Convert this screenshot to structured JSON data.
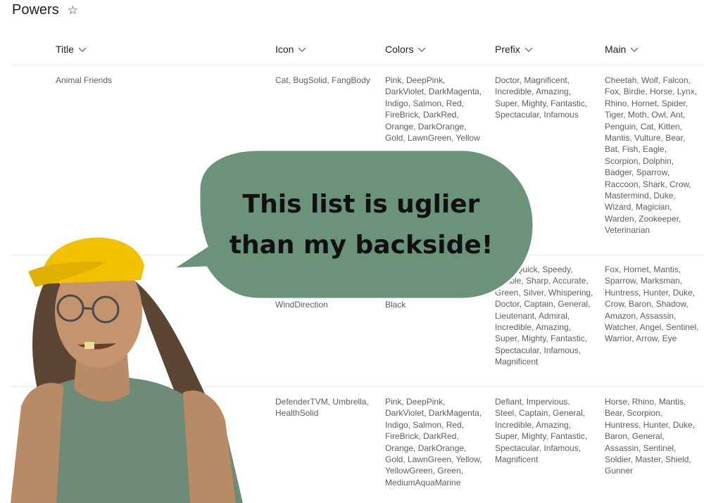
{
  "page": {
    "title": "Powers",
    "star_icon": "star-outline-icon"
  },
  "columns": [
    {
      "label": "Title"
    },
    {
      "label": "Icon"
    },
    {
      "label": "Colors"
    },
    {
      "label": "Prefix"
    },
    {
      "label": "Main"
    }
  ],
  "rows": [
    {
      "title": "Animal Friends",
      "icon": "Cat, BugSolid, FangBody",
      "colors": "Pink, DeepPink, DarkViolet, DarkMagenta, Indigo, Salmon, Red, FireBrick, DarkRed, Orange, DarkOrange, Gold, LawnGreen, Yellow",
      "prefix": "Doctor, Magnificent, Incredible, Amazing, Super, Mighty, Fantastic, Spectacular, Infamous",
      "main": "Cheetah, Wolf, Falcon, Fox, Birdie, Horse, Lynx, Rhino, Hornet, Spider, Tiger, Moth, Owl, Ant, Penguin, Cat, Kitten, Mantis, Vulture, Bear, Bat, Fish, Eagle, Scorpion, Dolphin, Badger, Sparrow, Raccoon, Shark, Crow, Mastermind, Duke, Wizard, Magician, Warden, Zookeeper, Veterinarian"
    },
    {
      "title": "",
      "icon": "WindDirection",
      "colors": "Black",
      "prefix": "Fast, Quick, Speedy, Nimble, Sharp, Accurate, Green, Silver, Whispering, Doctor, Captain, General, Lieutenant, Admiral, Incredible, Amazing, Super, Mighty, Fantastic, Spectacular, Infamous, Magnificent",
      "main": "Fox, Hornet, Mantis, Sparrow, Marksman, Huntress, Hunter, Duke, Crow, Baron, Shadow, Amazon, Assassin, Watcher, Angel, Sentinel, Warrior, Arrow, Eye"
    },
    {
      "title": "",
      "icon": "DefenderTVM, Umbrella, HealthSolid",
      "colors": "Pink, DeepPink, DarkViolet, DarkMagenta, Indigo, Salmon, Red, FireBrick, DarkRed, Orange, DarkOrange, Gold, LawnGreen, Yellow, YellowGreen, Green, MediumAquaMarine",
      "prefix": "Defiant, Impervious, Steel, Captain, General, Incredible, Amazing, Super, Mighty, Fantastic, Spectacular, Infamous, Magnificent",
      "main": "Horse, Rhino, Mantis, Bear, Scorpion, Huntress, Hunter, Duke, Baron, General, Assassin, Sentinel, Soldier, Master, Shield, Gunner"
    }
  ],
  "overlay": {
    "bubble_line1": "This list is uglier",
    "bubble_line2": "than my backside!",
    "bubble_color": "#6b9379",
    "person_image": "cartoon-person-with-cap"
  }
}
